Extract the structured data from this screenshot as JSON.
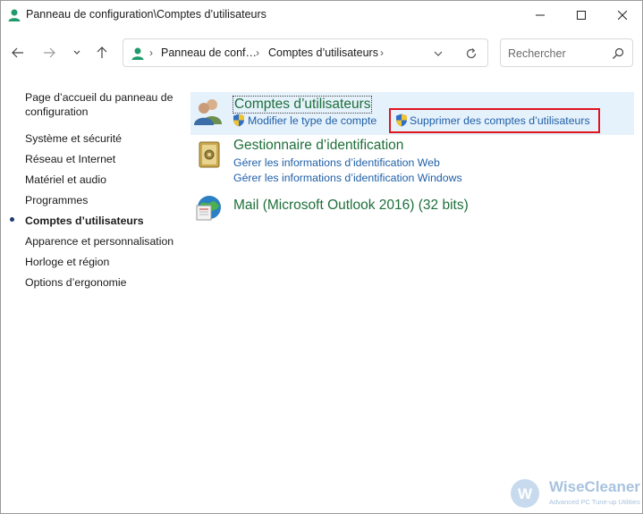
{
  "window": {
    "title": "Panneau de configuration\\Comptes d’utilisateurs"
  },
  "address_bar": {
    "crumbs": [
      "Panneau de conf…",
      "Comptes d’utilisateurs"
    ]
  },
  "search": {
    "placeholder": "Rechercher"
  },
  "sidebar": {
    "home_line1": "Page d’accueil du panneau de",
    "home_line2": "configuration",
    "items": [
      {
        "label": "Système et sécurité",
        "active": false
      },
      {
        "label": "Réseau et Internet",
        "active": false
      },
      {
        "label": "Matériel et audio",
        "active": false
      },
      {
        "label": "Programmes",
        "active": false
      },
      {
        "label": "Comptes d’utilisateurs",
        "active": true
      },
      {
        "label": "Apparence et personnalisation",
        "active": false
      },
      {
        "label": "Horloge et région",
        "active": false
      },
      {
        "label": "Options d’ergonomie",
        "active": false
      }
    ]
  },
  "categories": [
    {
      "title": "Comptes d’utilisateurs",
      "links": [
        "Modifier le type de compte",
        "Supprimer des comptes d’utilisateurs"
      ]
    },
    {
      "title": "Gestionnaire d’identification",
      "links": [
        "Gérer les informations d’identification Web",
        "Gérer les informations d’identification Windows"
      ]
    },
    {
      "title": "Mail (Microsoft Outlook 2016) (32 bits)",
      "links": []
    }
  ],
  "watermark": {
    "name": "WiseCleaner",
    "tagline": "Advanced PC Tune-up Utilities"
  },
  "colors": {
    "category_title": "#1e6f3a",
    "link": "#1f5fa8",
    "highlight_bg": "#e5f1fb",
    "annotation_red": "#e0141e"
  }
}
